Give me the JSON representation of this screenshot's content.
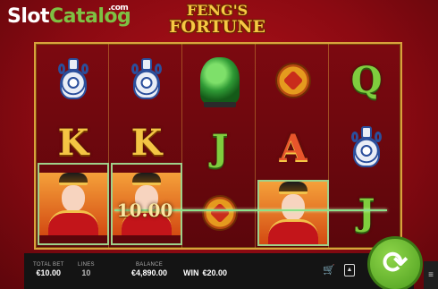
{
  "watermark": {
    "slot": "Slot",
    "catalog": "Catalog",
    "com": ".com"
  },
  "game_logo": {
    "line1": "FENG'S",
    "line2": "FORTUNE"
  },
  "reels": [
    {
      "symbols": [
        "blue-vase",
        "K",
        "lady",
        "K"
      ]
    },
    {
      "symbols": [
        "blue-vase",
        "K",
        "lady"
      ]
    },
    {
      "symbols": [
        "jade-dragon",
        "J",
        "gold-coin"
      ]
    },
    {
      "symbols": [
        "gold-coin",
        "A",
        "lady"
      ]
    },
    {
      "symbols": [
        "Q",
        "blue-vase",
        "J"
      ]
    }
  ],
  "symbol_labels": {
    "K": "K",
    "J": "J",
    "A": "A",
    "Q": "Q"
  },
  "win_overlay": "10.00",
  "bottom_bar": {
    "total_bet_label": "TOTAL BET",
    "total_bet_value": "€10.00",
    "lines_label": "LINES",
    "lines_value": "10",
    "balance_label": "BALANCE",
    "balance_value": "€4,890.00",
    "win_label": "WIN",
    "win_value": "€20.00"
  },
  "icons": {
    "spin": "refresh-icon",
    "cart": "cart-icon",
    "bet": "bet-icon",
    "settings": "settings-icon"
  },
  "colors": {
    "background": "#9e0f17",
    "frame_gold": "#d9a13c",
    "spin_green": "#6fbf2f",
    "payline": "#8be08a"
  }
}
